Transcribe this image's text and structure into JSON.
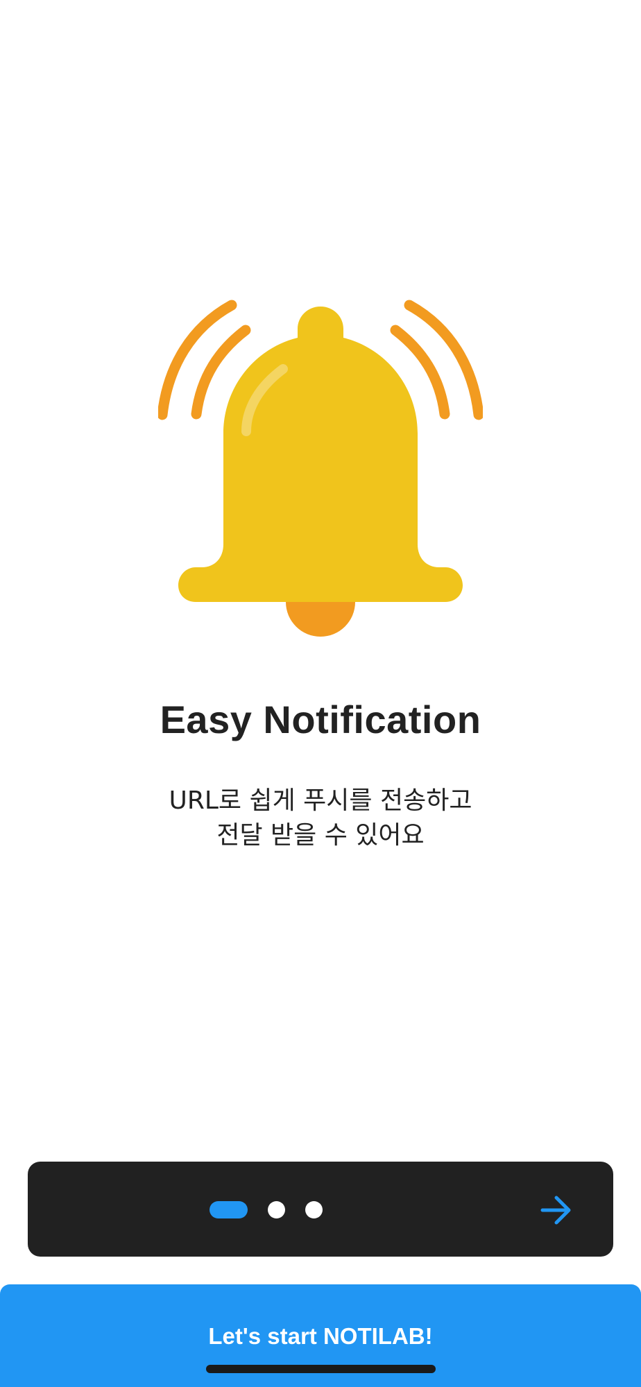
{
  "onboarding": {
    "illustration_icon": "ringing-bell-icon",
    "title": "Easy Notification",
    "description_lines": [
      "URL로 쉽게 푸시를 전송하고",
      "전달 받을 수 있어요"
    ]
  },
  "pager": {
    "page_count": 3,
    "current_page": 1,
    "next_icon": "arrow-right-icon"
  },
  "cta": {
    "label": "Let's start NOTILAB!"
  },
  "colors": {
    "accent": "#2196F3",
    "bell_yellow": "#F0C41C",
    "bell_orange": "#F29B20",
    "text_dark": "#222222",
    "pager_background": "#212121"
  }
}
